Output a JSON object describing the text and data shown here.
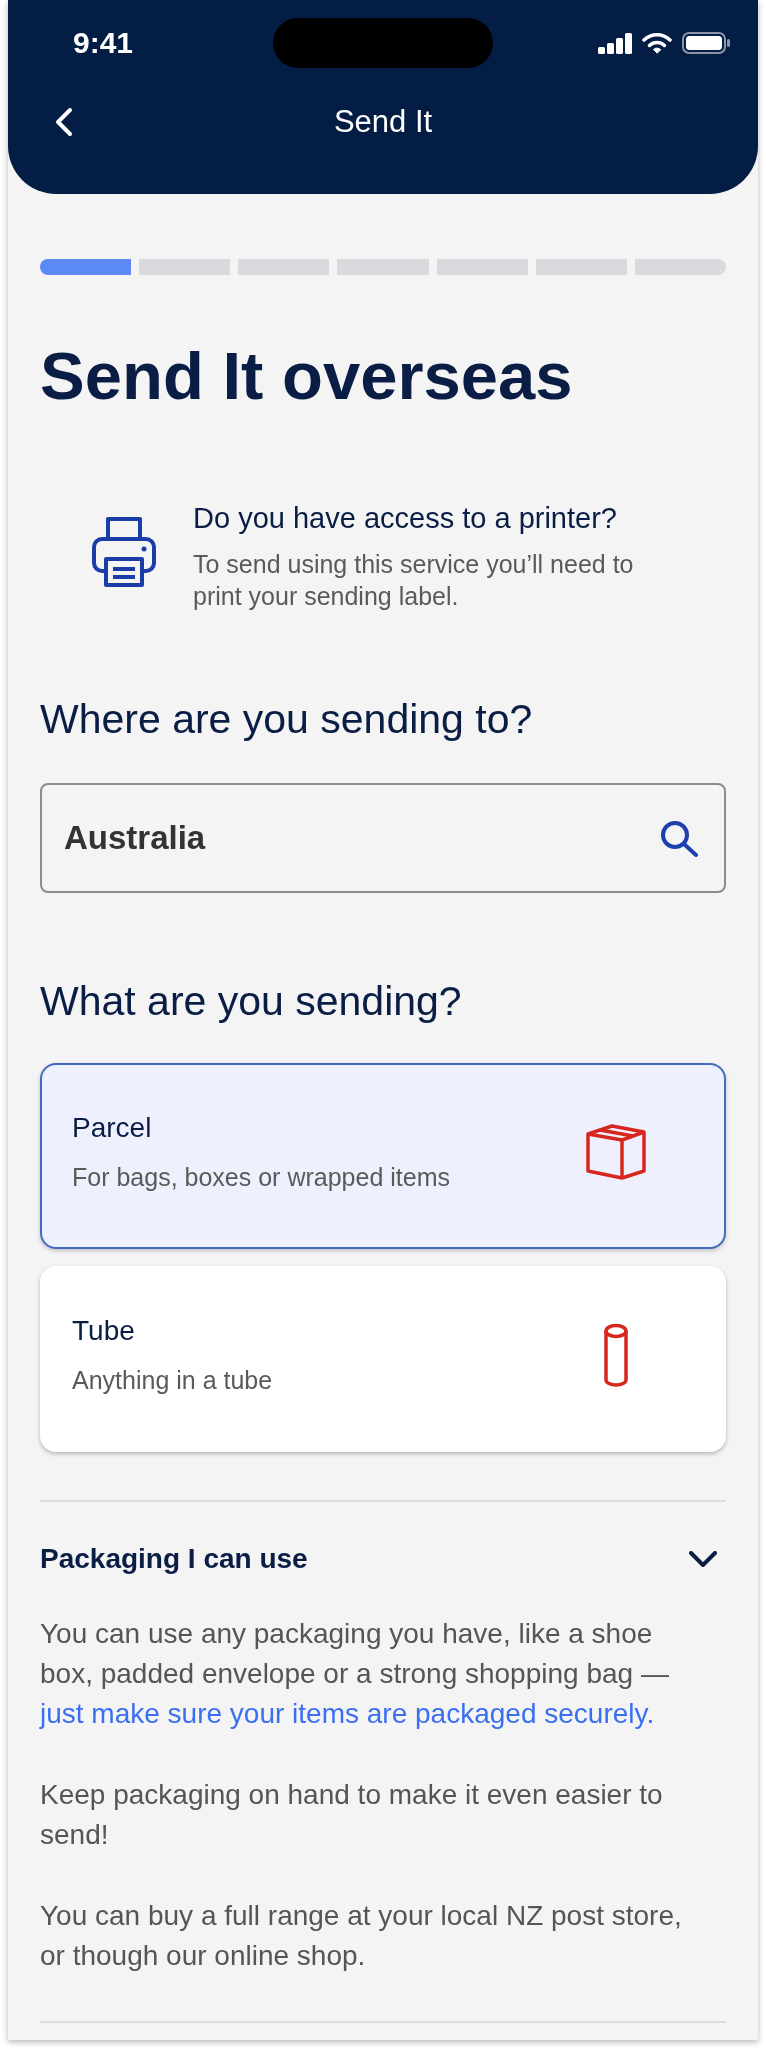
{
  "status_bar": {
    "time": "9:41"
  },
  "nav_bar": {
    "title": "Send It"
  },
  "progress": {
    "steps": [
      {
        "done": true
      },
      {
        "done": false
      },
      {
        "done": false
      },
      {
        "done": false
      },
      {
        "done": false
      },
      {
        "done": false
      },
      {
        "done": false
      }
    ]
  },
  "title": "Send It overseas",
  "printer_notice": {
    "title": "Do you have access to a printer?",
    "text": "To send using this service you’ll need to print your sending label."
  },
  "destination": {
    "heading": "Where are you sending to?",
    "search": {
      "value": "Australia"
    }
  },
  "item_type": {
    "heading": "What are you sending?",
    "options": [
      {
        "kind": "parcel",
        "title": "Parcel",
        "description": "For bags, boxes or wrapped items",
        "selected": true
      },
      {
        "kind": "tube",
        "title": "Tube",
        "description": "Anything in a tube",
        "selected": false
      }
    ]
  },
  "accordion": {
    "title": "Packaging I can use",
    "expanded": true,
    "paragraphs": [
      {
        "text": "You can use any packaging you have, like a shoe box, padded envelope or a strong shopping bag —",
        "link": "just make sure your items are packaged securely."
      },
      {
        "text": "Keep packaging on hand to make it even easier to send!"
      },
      {
        "text": "You can buy a full range at your local NZ post store, or though our online shop."
      }
    ]
  }
}
